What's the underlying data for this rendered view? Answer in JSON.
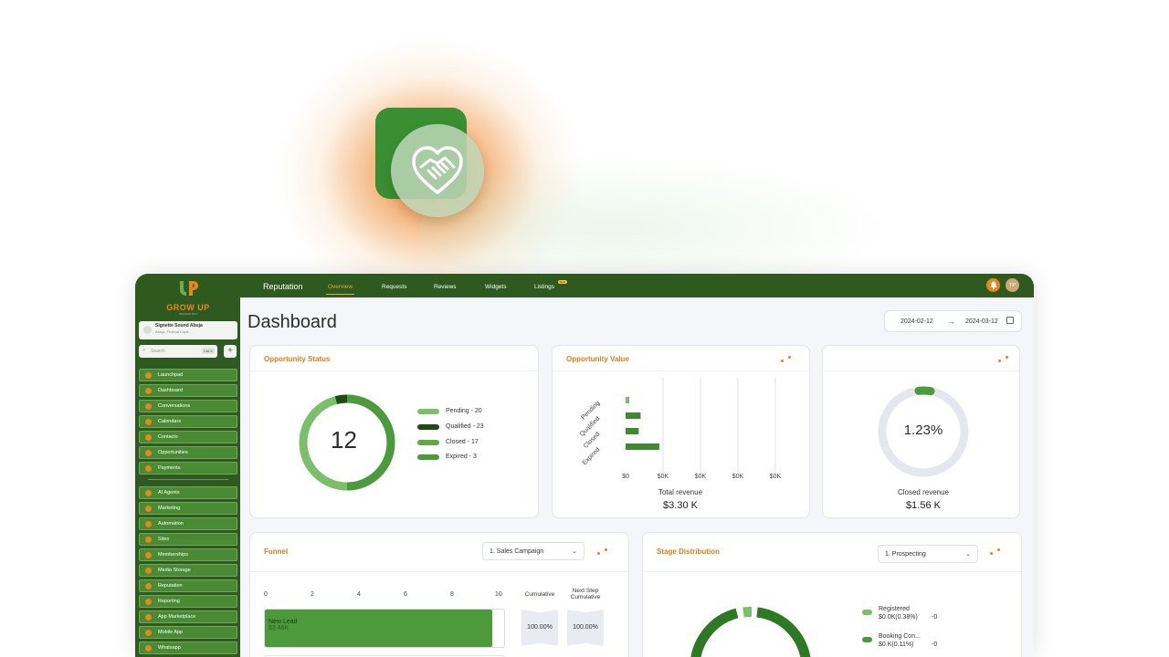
{
  "app": {
    "brand": "Reputation",
    "logo_text": "GROW UP",
    "logo_sub": "TECHNOLOGY",
    "colors": {
      "primary": "#2f5a1f",
      "accent": "#e8851c",
      "series_light": "#7cbf6a",
      "series_dark": "#1e4a14",
      "series_mid": "#4c9a3c"
    }
  },
  "tabs": [
    {
      "label": "Overview",
      "active": true
    },
    {
      "label": "Requests"
    },
    {
      "label": "Reviews"
    },
    {
      "label": "Widgets"
    },
    {
      "label": "Listings",
      "badge": "New"
    }
  ],
  "user": {
    "initials": "TP"
  },
  "sidebar": {
    "location_name": "Signette Sound Abuja",
    "location_sub": "Abuja, Federal Capit...",
    "search_placeholder": "Search",
    "search_shortcut": "Ctrl K",
    "items": [
      {
        "label": "Launchpad"
      },
      {
        "label": "Dashboard"
      },
      {
        "label": "Conversations"
      },
      {
        "label": "Calendars"
      },
      {
        "label": "Contacts"
      },
      {
        "label": "Opportunities"
      },
      {
        "label": "Payments"
      },
      {
        "label": "AI Agents"
      },
      {
        "label": "Marketing"
      },
      {
        "label": "Automation"
      },
      {
        "label": "Sites"
      },
      {
        "label": "Memberships"
      },
      {
        "label": "Media Storage"
      },
      {
        "label": "Reputation"
      },
      {
        "label": "Reporting"
      },
      {
        "label": "App Marketplace"
      },
      {
        "label": "Mobile App"
      },
      {
        "label": "Whatsapp"
      }
    ]
  },
  "page": {
    "title": "Dashboard",
    "date_from": "2024-02-12",
    "date_to": "2024-03-12",
    "arrow": "→"
  },
  "opportunity_status": {
    "title": "Opportunity Status",
    "total": "12",
    "legend": [
      {
        "label": "Pending - 20",
        "color": "#7cbf6a"
      },
      {
        "label": "Qualified - 23",
        "color": "#1e4a14"
      },
      {
        "label": "Closed - 17",
        "color": "#5ea84a"
      },
      {
        "label": "Expired - 3",
        "color": "#4c9a3c"
      }
    ]
  },
  "opportunity_value": {
    "title": "Opportunity Value",
    "total_label": "Total revenue",
    "total_value": "$3.30 K"
  },
  "conversion": {
    "value": "1.23%",
    "label": "Closed revenue",
    "amount": "$1.56 K"
  },
  "funnel": {
    "title": "Funnel",
    "select": "1. Sales Campaign",
    "axis": [
      "0",
      "2",
      "4",
      "6",
      "8",
      "10"
    ],
    "col_cumulative": "Cumulative",
    "col_next": "Next Step Cumulative",
    "row_label": "New Lead",
    "row_value": "$3.46K",
    "cumulative": "100.00%",
    "next_step": "100.00%",
    "bar_fraction": 0.95
  },
  "stage_distribution": {
    "title": "Stage Distribution",
    "select": "1. Prospecting",
    "legend": [
      {
        "name": "Registered",
        "value": "$0.0K(0.38%)",
        "extra": "-0"
      },
      {
        "name": "Booking Con...",
        "value": "$0.K(0.11%)",
        "extra": "-0"
      }
    ]
  },
  "chart_data": {
    "type": "bar",
    "orientation": "horizontal",
    "categories": [
      "Pending",
      "Qualified",
      "Closed",
      "Expired"
    ],
    "values": [
      0.1,
      0.4,
      0.35,
      0.9
    ],
    "x_tick_labels": [
      "$0",
      "$0K",
      "$0K",
      "$0K",
      "$0K"
    ],
    "grid": true
  }
}
